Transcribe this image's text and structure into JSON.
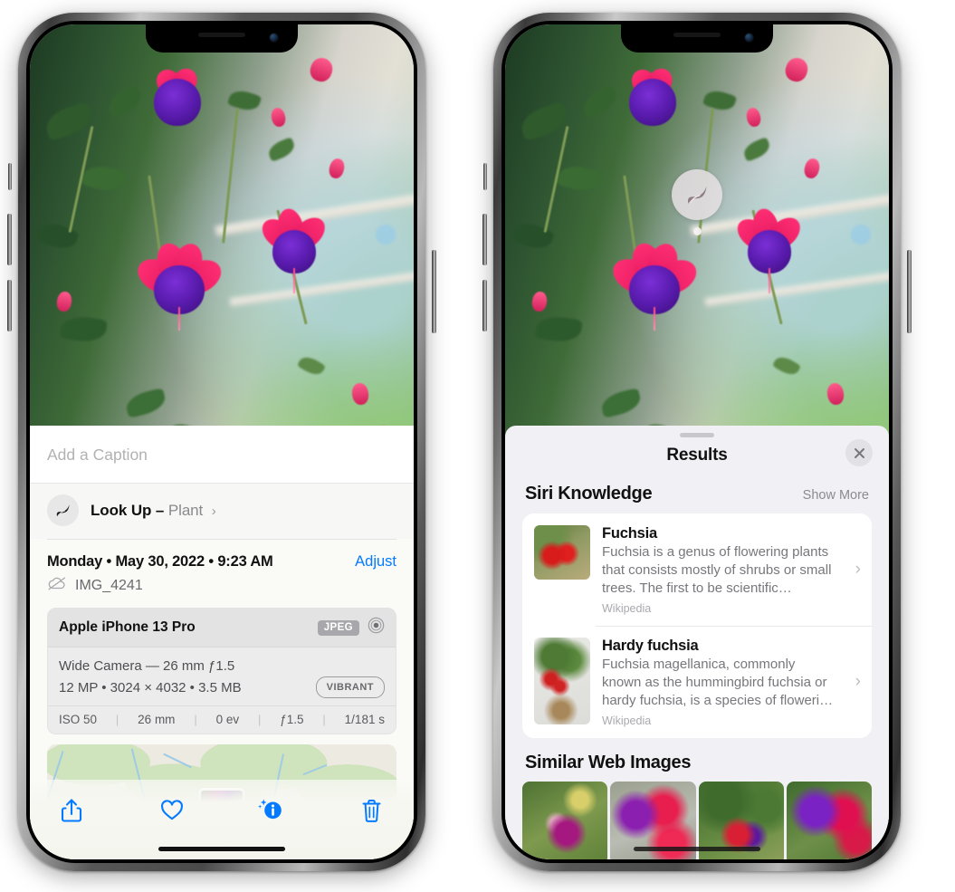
{
  "left_phone": {
    "name": "photos-info-screen",
    "caption": {
      "placeholder": "Add a Caption",
      "value": ""
    },
    "lookup": {
      "label": "Look Up",
      "dash": "–",
      "subject": "Plant",
      "chevron": "›",
      "icon": "leaf-icon"
    },
    "metadata": {
      "date": "Monday • May 30, 2022 • 9:23 AM",
      "adjust": "Adjust",
      "filename": "IMG_4241",
      "cloud_icon": "icloud-slash-icon"
    },
    "exif": {
      "device": "Apple iPhone 13 Pro",
      "format_badge": "JPEG",
      "lens_icon": "aperture-icon",
      "lens_line": "Wide Camera — 26 mm ƒ1.5",
      "size_line": "12 MP • 3024 × 4032 • 3.5 MB",
      "style_badge": "VIBRANT",
      "stats": [
        {
          "label": "ISO 50"
        },
        {
          "label": "26 mm"
        },
        {
          "label": "0 ev"
        },
        {
          "label": "ƒ1.5"
        },
        {
          "label": "1/181 s"
        }
      ],
      "divider": "|"
    },
    "toolbar": {
      "share": "share-icon",
      "favorite": "heart-icon",
      "info": "info-sparkle-icon",
      "delete": "trash-icon"
    },
    "accent_color": "#037aff"
  },
  "right_phone": {
    "name": "visual-lookup-results-screen",
    "photo_badge": {
      "icon": "leaf-icon",
      "label": "plant-detected-badge"
    },
    "sheet": {
      "title": "Results",
      "close_label": "×"
    },
    "siri_knowledge": {
      "title": "Siri Knowledge",
      "show_more": "Show More",
      "results": [
        {
          "title": "Fuchsia",
          "description": "Fuchsia is a genus of flowering plants that consists mostly of shrubs or small trees. The first to be scientific…",
          "source": "Wikipedia",
          "chevron": "›"
        },
        {
          "title": "Hardy fuchsia",
          "description": "Fuchsia magellanica, commonly known as the hummingbird fuchsia or hardy fuchsia, is a species of floweri…",
          "source": "Wikipedia",
          "chevron": "›"
        }
      ]
    },
    "similar_web_images": {
      "title": "Similar Web Images",
      "items": [
        {
          "alt": "fuchsia-flower-image-1"
        },
        {
          "alt": "fuchsia-flower-image-2"
        },
        {
          "alt": "fuchsia-flower-image-3"
        },
        {
          "alt": "fuchsia-flower-image-4"
        }
      ]
    }
  }
}
